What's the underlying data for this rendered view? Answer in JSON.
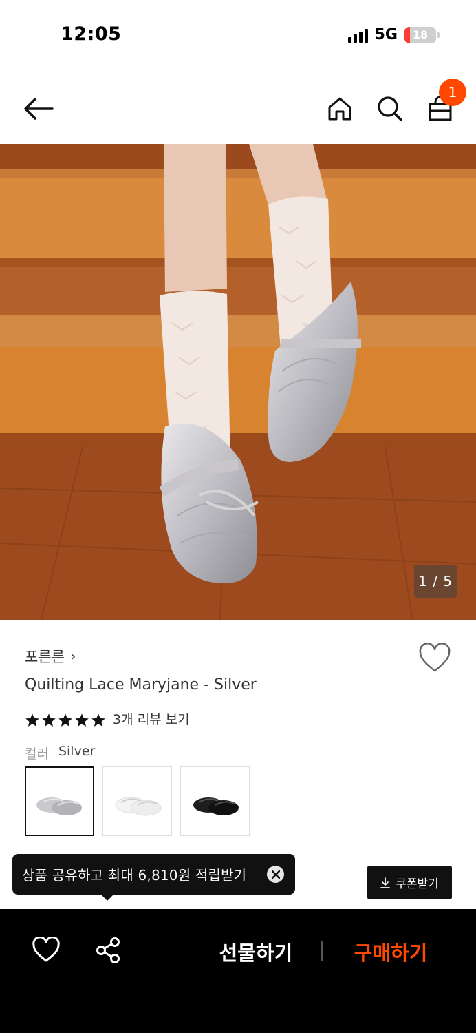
{
  "status_bar": {
    "time": "12:05",
    "network": "5G",
    "battery": "18",
    "battery_level": 0.18
  },
  "nav": {
    "icons": [
      "back-arrow-icon",
      "home-icon",
      "search-icon",
      "shopping-bag-icon"
    ],
    "cart_count": "1"
  },
  "image": {
    "counter": "1 / 5"
  },
  "product": {
    "brand": "포른른",
    "brand_chevron": "›",
    "title": "Quilting Lace Maryjane - Silver",
    "rating_stars": 5,
    "review_link": "3개 리뷰 보기",
    "color_label": "컬러",
    "color_value": "Silver",
    "swatches": [
      "silver",
      "white",
      "black"
    ]
  },
  "tooltip": {
    "text": "상품 공유하고 최대 6,810원 적립받기"
  },
  "coupon": {
    "label": "쿠폰받기"
  },
  "bottom_bar": {
    "gift_label": "선물하기",
    "buy_label": "구매하기",
    "accent_color": "#ff4800"
  }
}
